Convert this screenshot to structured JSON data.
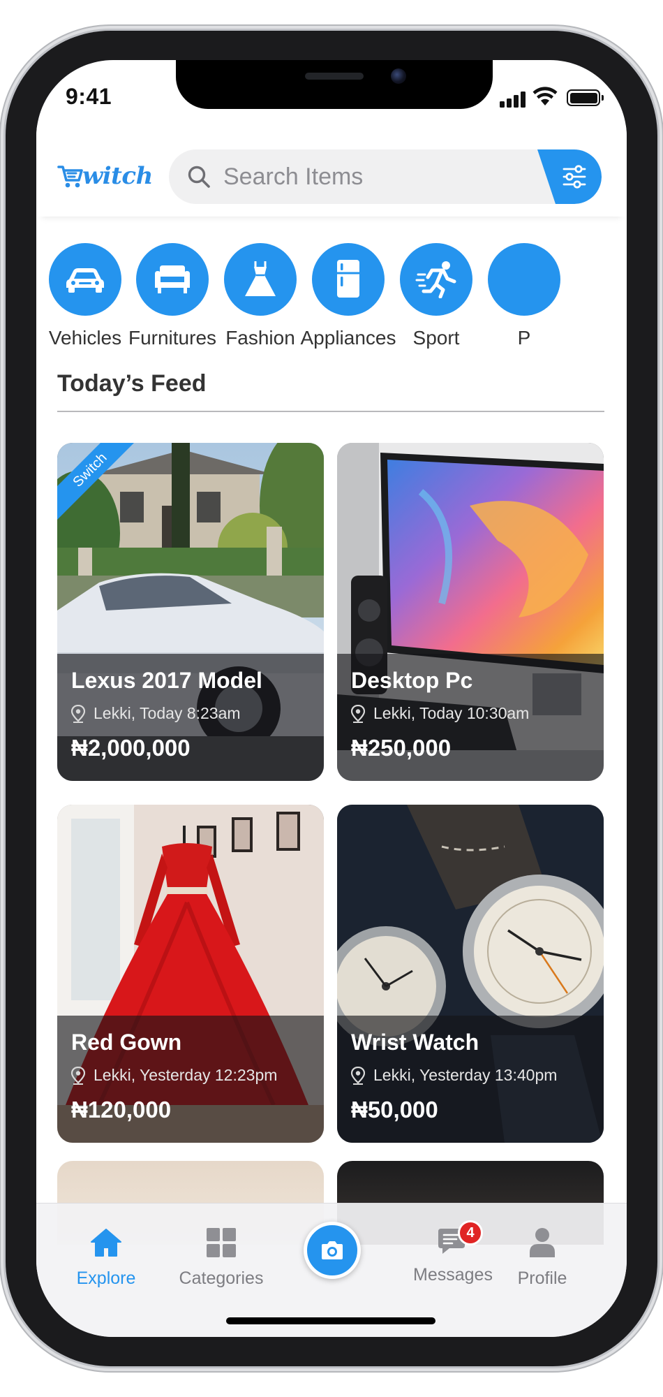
{
  "status_bar": {
    "time": "9:41"
  },
  "header": {
    "logo_text": "witch",
    "search_placeholder": "Search Items"
  },
  "categories": [
    {
      "label": "Vehicles",
      "icon": "car-icon"
    },
    {
      "label": "Furnitures",
      "icon": "sofa-icon"
    },
    {
      "label": "Fashion",
      "icon": "dress-icon"
    },
    {
      "label": "Appliances",
      "icon": "fridge-icon"
    },
    {
      "label": "Sport",
      "icon": "runner-icon"
    },
    {
      "label": "P",
      "icon": "partial-category-icon"
    }
  ],
  "feed": {
    "title": "Today’s Feed",
    "ribbon": "Switch",
    "items": [
      {
        "title": "Lexus 2017 Model",
        "location": "Lekki, Today 8:23am",
        "price": "₦2,000,000"
      },
      {
        "title": "Desktop Pc",
        "location": "Lekki, Today 10:30am",
        "price": "₦250,000"
      },
      {
        "title": "Red Gown",
        "location": "Lekki, Yesterday 12:23pm",
        "price": "₦120,000"
      },
      {
        "title": "Wrist Watch",
        "location": "Lekki, Yesterday 13:40pm",
        "price": "₦50,000"
      }
    ]
  },
  "tabbar": {
    "tabs": [
      {
        "label": "Explore",
        "icon": "home-icon",
        "active": true
      },
      {
        "label": "Categories",
        "icon": "grid-icon"
      },
      {
        "label": "",
        "icon": "camera-icon"
      },
      {
        "label": "Messages",
        "icon": "chat-icon",
        "badge": "4"
      },
      {
        "label": "Profile",
        "icon": "user-icon"
      }
    ]
  },
  "colors": {
    "accent": "#2594ee",
    "badge": "#e02424",
    "text": "#333333"
  }
}
